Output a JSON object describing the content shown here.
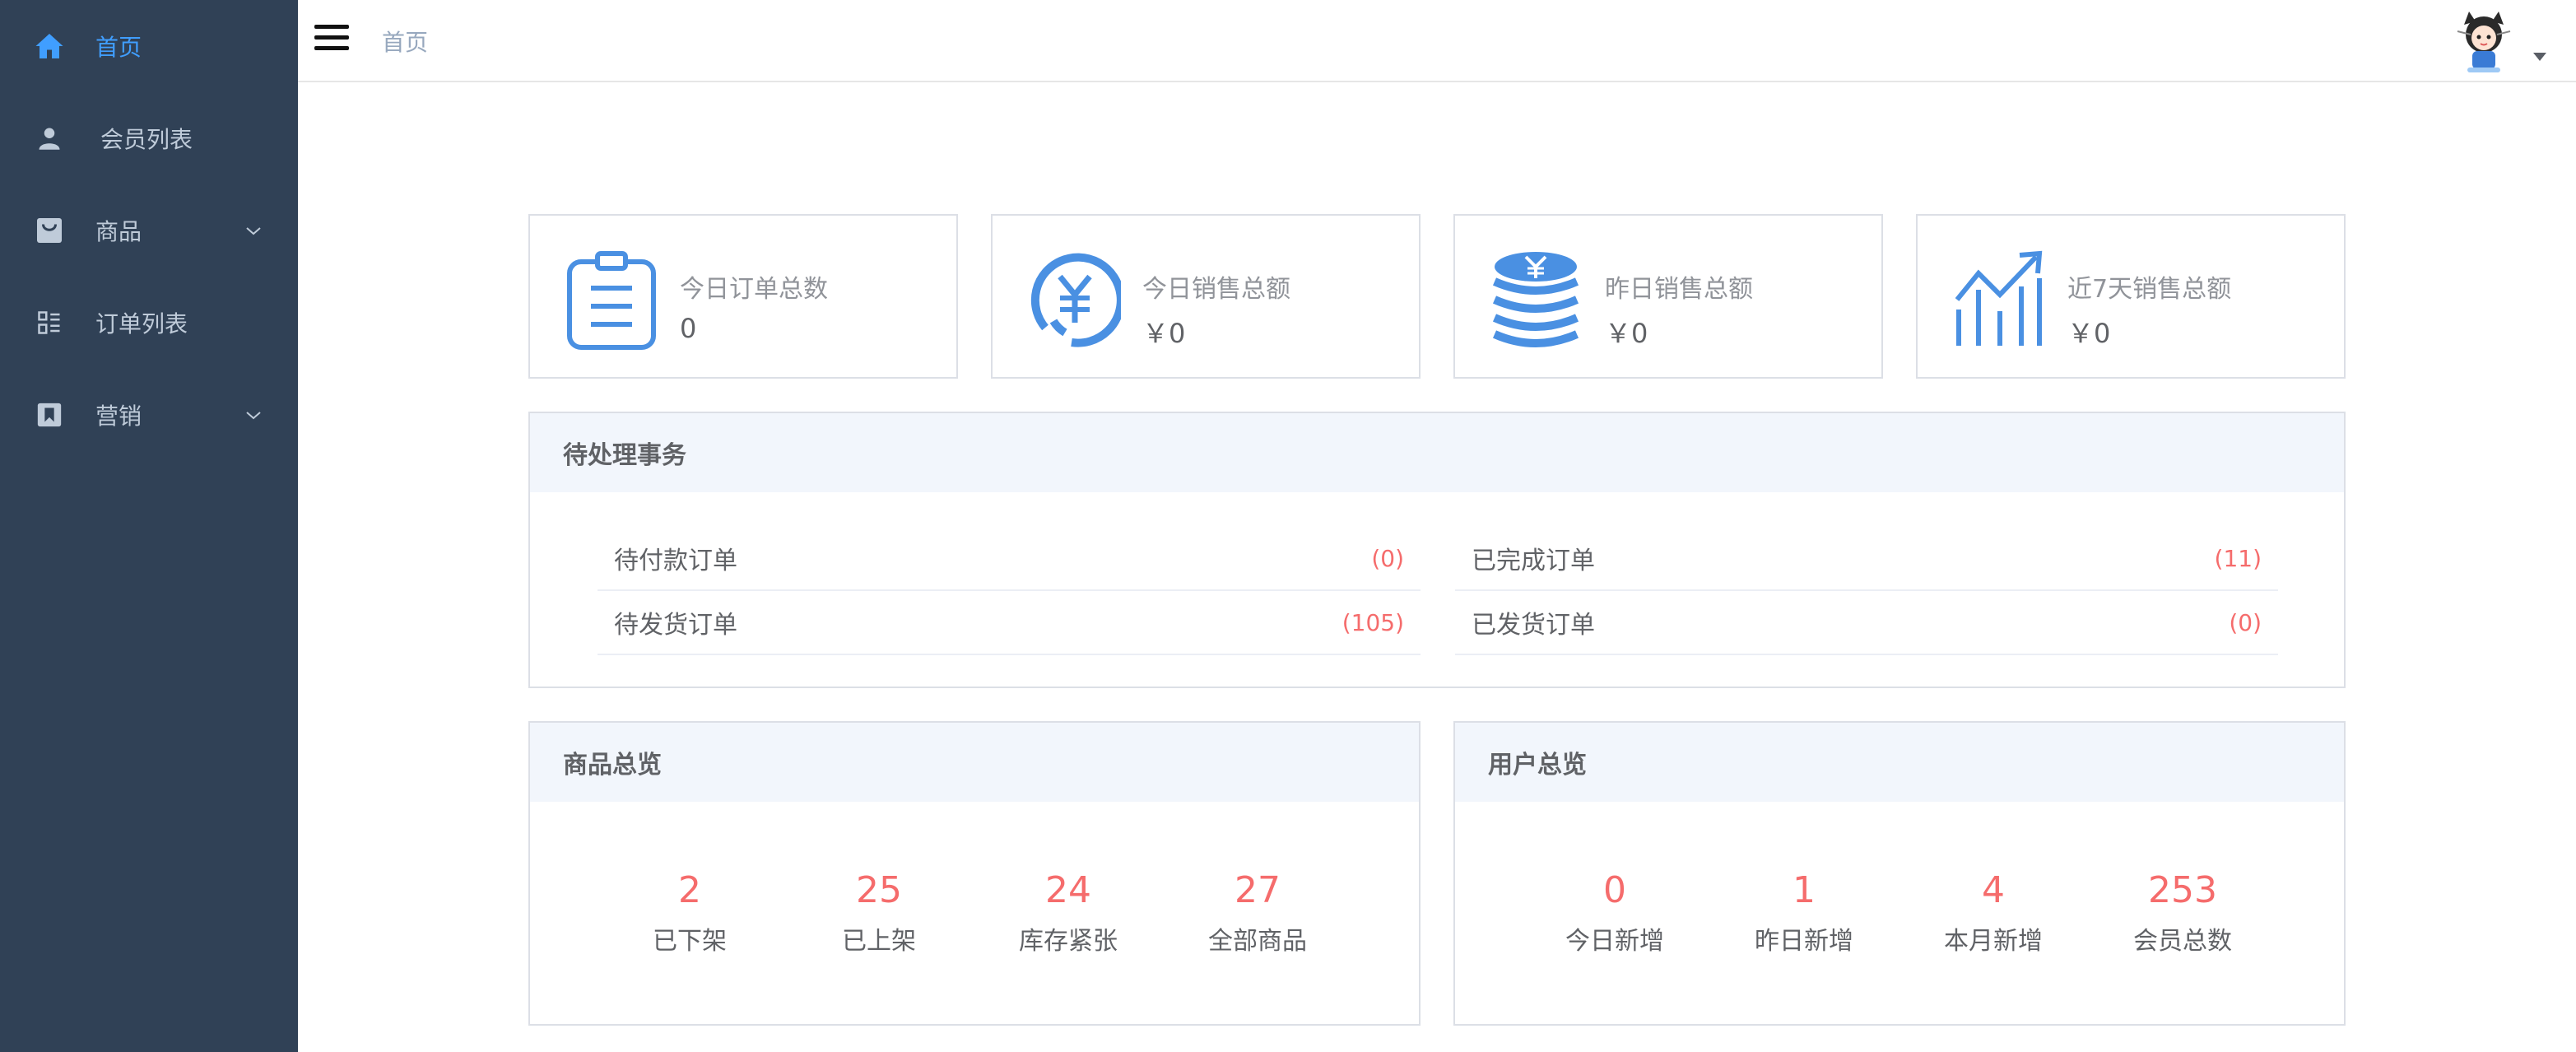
{
  "sidebar": {
    "items": [
      {
        "label": "首页",
        "icon": "home-icon",
        "active": true
      },
      {
        "label": "会员列表",
        "icon": "user-icon"
      },
      {
        "label": "商品",
        "icon": "shopping-bag-icon",
        "expandable": true
      },
      {
        "label": "订单列表",
        "icon": "list-icon"
      },
      {
        "label": "营销",
        "icon": "bookmark-icon",
        "expandable": true
      }
    ]
  },
  "header": {
    "breadcrumb": "首页"
  },
  "stats": [
    {
      "title": "今日订单总数",
      "value": "0",
      "icon": "clipboard-icon"
    },
    {
      "title": "今日销售总额",
      "value": "￥0",
      "icon": "yuan-circle-icon"
    },
    {
      "title": "昨日销售总额",
      "value": "￥0",
      "icon": "coin-stack-icon"
    },
    {
      "title": "近7天销售总额",
      "value": "￥0",
      "icon": "trend-chart-icon"
    }
  ],
  "pending": {
    "title": "待处理事务",
    "rows": [
      {
        "label": "待付款订单",
        "count": "(0)"
      },
      {
        "label": "已完成订单",
        "count": "(11)"
      },
      {
        "label": "待发货订单",
        "count": "(105)"
      },
      {
        "label": "已发货订单",
        "count": "(0)"
      }
    ]
  },
  "goods": {
    "title": "商品总览",
    "items": [
      {
        "num": "2",
        "label": "已下架"
      },
      {
        "num": "25",
        "label": "已上架"
      },
      {
        "num": "24",
        "label": "库存紧张"
      },
      {
        "num": "27",
        "label": "全部商品"
      }
    ]
  },
  "users": {
    "title": "用户总览",
    "items": [
      {
        "num": "0",
        "label": "今日新增"
      },
      {
        "num": "1",
        "label": "昨日新增"
      },
      {
        "num": "4",
        "label": "本月新增"
      },
      {
        "num": "253",
        "label": "会员总数"
      }
    ]
  },
  "colors": {
    "sidebar_bg": "#304156",
    "active": "#409eff",
    "accent_red": "#f56c6c",
    "icon_blue": "#4a90e2"
  }
}
